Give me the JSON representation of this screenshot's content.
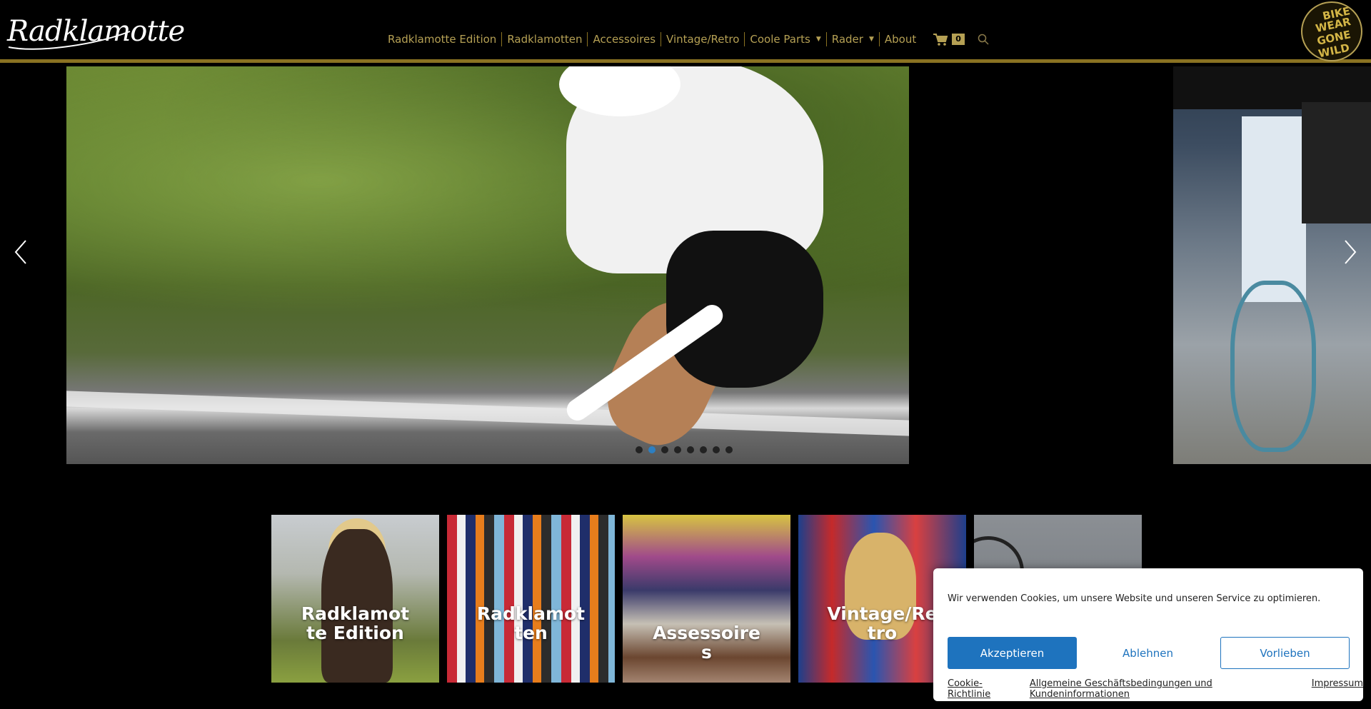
{
  "header": {
    "logo_text": "Radklamotte",
    "nav": [
      {
        "label": "Radklamotte Edition",
        "has_dropdown": false
      },
      {
        "label": "Radklamotten",
        "has_dropdown": false
      },
      {
        "label": "Accessoires",
        "has_dropdown": false
      },
      {
        "label": "Vintage/Retro",
        "has_dropdown": false
      },
      {
        "label": "Coole Parts",
        "has_dropdown": true
      },
      {
        "label": "Rader",
        "has_dropdown": true
      },
      {
        "label": "About",
        "has_dropdown": false
      }
    ],
    "cart_count": "0",
    "badge_logo_lines": [
      "BIKE",
      "WEAR",
      "GONE",
      "WILD"
    ],
    "accent_color": "#b5a054"
  },
  "slider": {
    "total_slides": 8,
    "active_slide": 2,
    "active_dot_color": "#2d7fc1"
  },
  "categories": [
    {
      "label": "Radklamotte Edition"
    },
    {
      "label": "Radklamotten"
    },
    {
      "label": "Assessoires"
    },
    {
      "label": "Vintage/Retro"
    },
    {
      "label": ""
    }
  ],
  "cookie": {
    "text": "Wir verwenden Cookies, um unsere Website und unseren Service zu optimieren.",
    "accept_label": "Akzeptieren",
    "deny_label": "Ablehnen",
    "prefs_label": "Vorlieben",
    "links": [
      "Cookie-Richtlinie",
      "Allgemeine Geschäftsbedingungen und Kundeninformationen",
      "Impressum"
    ],
    "button_color": "#1e73be"
  }
}
